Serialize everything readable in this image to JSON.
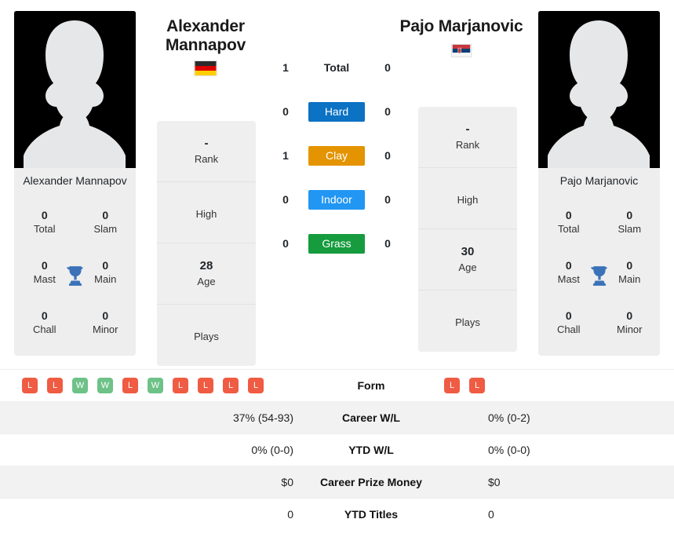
{
  "players": {
    "left": {
      "full_name": "Alexander\nMannapov",
      "card_name": "Alexander\nMannapov",
      "flag": "Germany",
      "avatar_icon": "person-silhouette-icon",
      "titles": {
        "total_value": "0",
        "total_label": "Total",
        "slam_value": "0",
        "slam_label": "Slam",
        "mast_value": "0",
        "mast_label": "Mast",
        "main_value": "0",
        "main_label": "Main",
        "chall_value": "0",
        "chall_label": "Chall",
        "minor_value": "0",
        "minor_label": "Minor",
        "trophy_icon": "trophy-icon"
      },
      "info": [
        {
          "value": "-",
          "label": "Rank",
          "has_value": true
        },
        {
          "value": "",
          "label": "High",
          "has_value": false
        },
        {
          "value": "28",
          "label": "Age",
          "has_value": true
        },
        {
          "value": "",
          "label": "Plays",
          "has_value": false
        }
      ],
      "form": [
        "L",
        "L",
        "W",
        "W",
        "L",
        "W",
        "L",
        "L",
        "L",
        "L"
      ]
    },
    "right": {
      "full_name": "Pajo Marjanovic",
      "card_name": "Pajo Marjanovic",
      "flag": "Serbia",
      "avatar_icon": "person-silhouette-icon",
      "titles": {
        "total_value": "0",
        "total_label": "Total",
        "slam_value": "0",
        "slam_label": "Slam",
        "mast_value": "0",
        "mast_label": "Mast",
        "main_value": "0",
        "main_label": "Main",
        "chall_value": "0",
        "chall_label": "Chall",
        "minor_value": "0",
        "minor_label": "Minor",
        "trophy_icon": "trophy-icon"
      },
      "info": [
        {
          "value": "-",
          "label": "Rank",
          "has_value": true
        },
        {
          "value": "",
          "label": "High",
          "has_value": false
        },
        {
          "value": "30",
          "label": "Age",
          "has_value": true
        },
        {
          "value": "",
          "label": "Plays",
          "has_value": false
        }
      ],
      "form": [
        "L",
        "L"
      ]
    }
  },
  "head_to_head": [
    {
      "label": "Total",
      "left": "1",
      "right": "0",
      "style": "plain",
      "color": ""
    },
    {
      "label": "Hard",
      "left": "0",
      "right": "0",
      "style": "badge",
      "color": "#0b72c4"
    },
    {
      "label": "Clay",
      "left": "1",
      "right": "0",
      "style": "badge",
      "color": "#e39400"
    },
    {
      "label": "Indoor",
      "left": "0",
      "right": "0",
      "style": "badge",
      "color": "#2196f3"
    },
    {
      "label": "Grass",
      "left": "0",
      "right": "0",
      "style": "badge",
      "color": "#169b3e"
    }
  ],
  "comparison_rows": [
    {
      "label": "Form",
      "left": "",
      "right": "",
      "type": "form"
    },
    {
      "label": "Career W/L",
      "left": "37% (54-93)",
      "right": "0% (0-2)",
      "type": "text"
    },
    {
      "label": "YTD W/L",
      "left": "0% (0-0)",
      "right": "0% (0-0)",
      "type": "text"
    },
    {
      "label": "Career Prize Money",
      "left": "$0",
      "right": "$0",
      "type": "text"
    },
    {
      "label": "YTD Titles",
      "left": "0",
      "right": "0",
      "type": "text"
    }
  ],
  "colors": {
    "win_badge": "#6ec288",
    "loss_badge": "#ef5b43",
    "hard": "#0b72c4",
    "clay": "#e39400",
    "indoor": "#2196f3",
    "grass": "#169b3e",
    "panel_bg": "#efefef",
    "stripe_bg": "#f2f2f2"
  }
}
